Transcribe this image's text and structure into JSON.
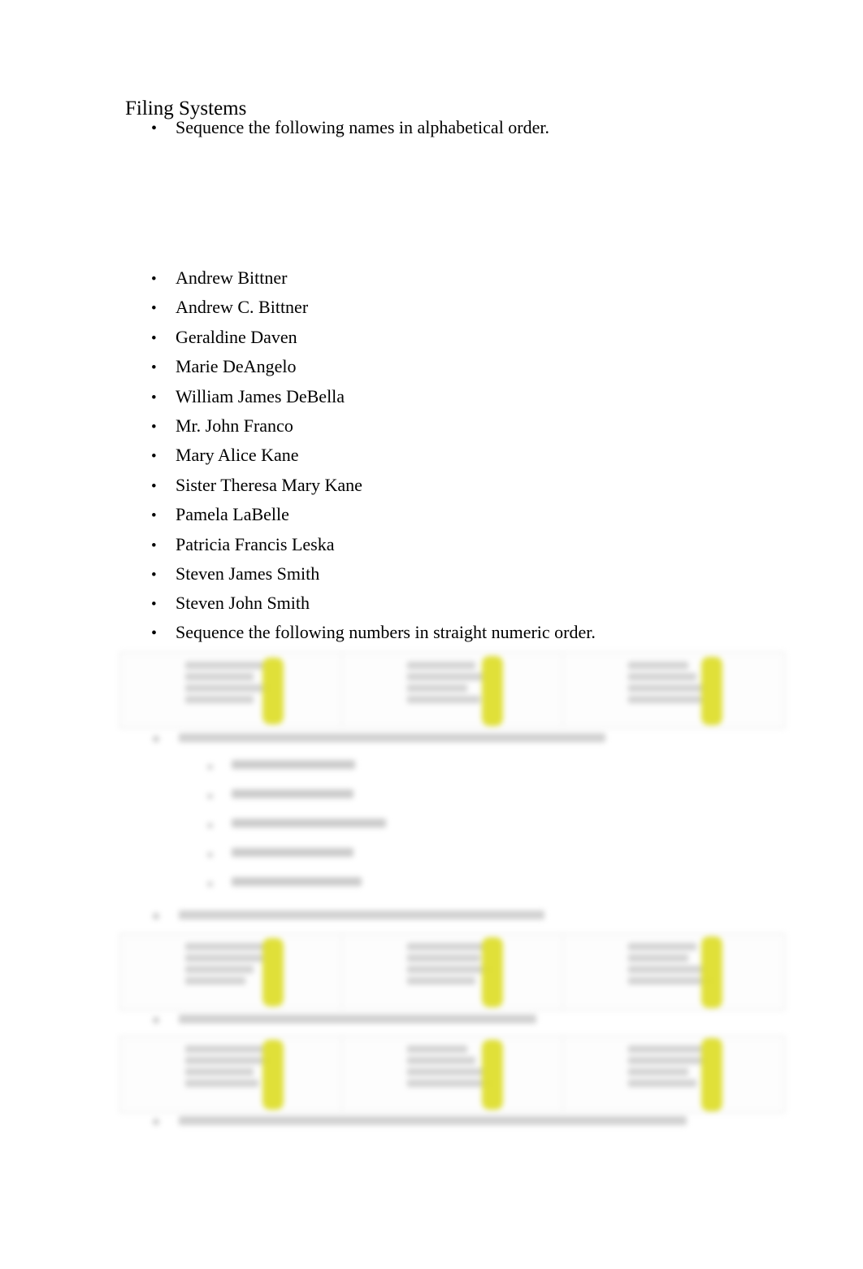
{
  "document": {
    "title": "Filing Systems",
    "background_color": "#ffffff",
    "text_color": "#000000",
    "highlight_color": "#dede2e"
  },
  "instructions": {
    "alphabetical": "Sequence the following names in alphabetical order.",
    "numeric": "Sequence the following numbers in straight numeric order."
  },
  "names": [
    {
      "label": "Andrew Bittner"
    },
    {
      "label": "Andrew C. Bittner"
    },
    {
      "label": "Geraldine Daven"
    },
    {
      "label": "Marie DeAngelo"
    },
    {
      "label": "William James DeBella"
    },
    {
      "label": "Mr. John Franco"
    },
    {
      "label": "Mary Alice Kane"
    },
    {
      "label": "Sister Theresa Mary Kane"
    },
    {
      "label": "Pamela LaBelle"
    },
    {
      "label": "Patricia Francis Leska"
    },
    {
      "label": "Steven James Smith"
    },
    {
      "label": "Steven John Smith"
    }
  ],
  "bullet_glyph": "•",
  "redacted": {
    "note": "lower portion of page is blurred and unreadable",
    "tables": 3,
    "columns_per_table": 3,
    "sub_list_items": 5
  }
}
